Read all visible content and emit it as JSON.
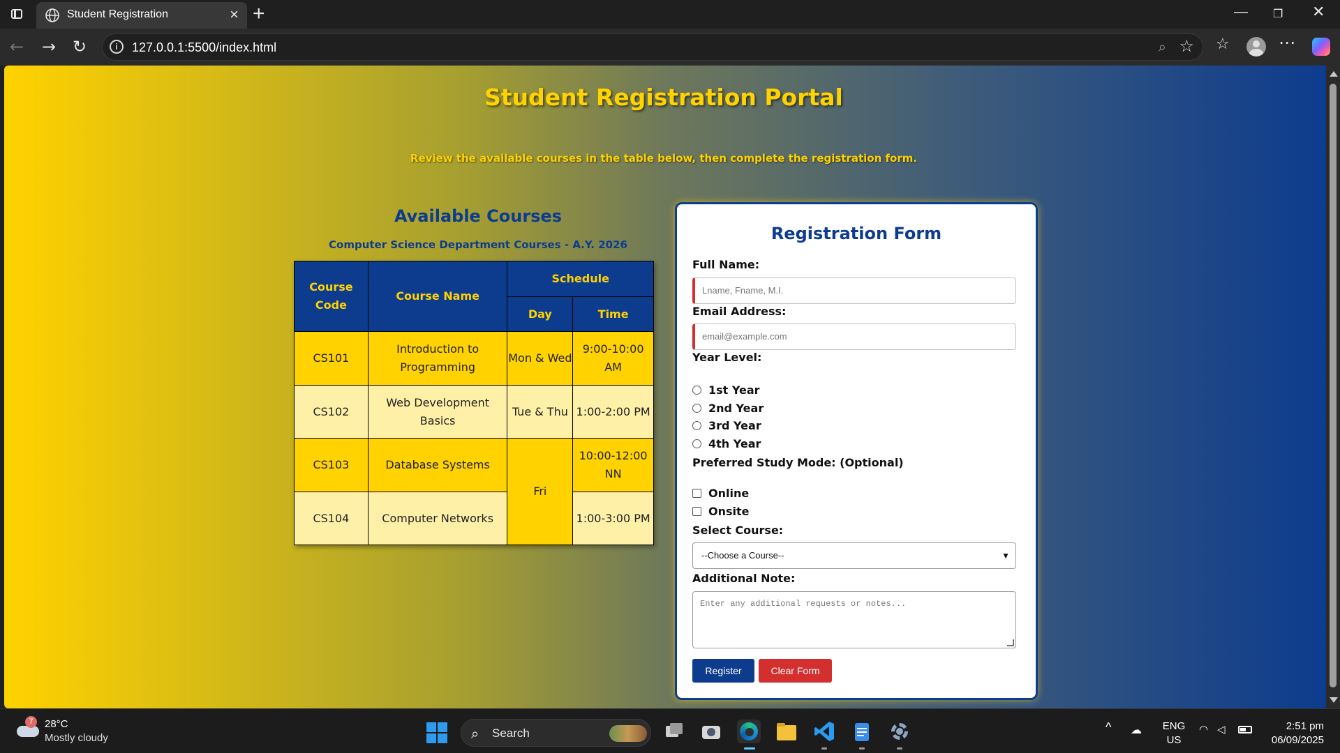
{
  "browser": {
    "tab_title": "Student Registration",
    "url": "127.0.0.1:5500/index.html"
  },
  "page": {
    "title": "Student Registration Portal",
    "subtitle": "Review the available courses in the table below, then complete the registration form."
  },
  "courses": {
    "title": "Available Courses",
    "caption": "Computer Science Department Courses - A.Y. 2026",
    "headers": {
      "code": "Course Code",
      "name": "Course Name",
      "schedule": "Schedule",
      "day": "Day",
      "time": "Time"
    },
    "rows": [
      {
        "code": "CS101",
        "name": "Introduction to Programming",
        "day": "Mon & Wed",
        "time": "9:00-10:00 AM"
      },
      {
        "code": "CS102",
        "name": "Web Development Basics",
        "day": "Tue & Thu",
        "time": "1:00-2:00 PM"
      },
      {
        "code": "CS103",
        "name": "Database Systems",
        "day": "Fri",
        "time": "10:00-12:00 NN"
      },
      {
        "code": "CS104",
        "name": "Computer Networks",
        "day": "Fri",
        "time": "1:00-3:00 PM"
      }
    ]
  },
  "form": {
    "title": "Registration Form",
    "full_name_label": "Full Name:",
    "full_name_placeholder": "Lname, Fname, M.I.",
    "full_name_value": "",
    "email_label": "Email Address:",
    "email_placeholder": "email@example.com",
    "email_value": "",
    "year_label": "Year Level:",
    "years": [
      "1st Year",
      "2nd Year",
      "3rd Year",
      "4th Year"
    ],
    "mode_label": "Preferred Study Mode: (Optional)",
    "modes": [
      "Online",
      "Onsite"
    ],
    "course_label": "Select Course:",
    "course_selected": "--Choose a Course--",
    "note_label": "Additional Note:",
    "note_placeholder": "Enter any additional requests or notes...",
    "register_label": "Register",
    "clear_label": "Clear Form"
  },
  "taskbar": {
    "weather_temp": "28°C",
    "weather_desc": "Mostly cloudy",
    "weather_badge": "7",
    "search_label": "Search",
    "lang_line1": "ENG",
    "lang_line2": "US",
    "time": "2:51 pm",
    "date": "06/09/2025"
  },
  "colors": {
    "navy": "#0d3c8e",
    "gold": "#ffd200",
    "light_gold": "#fff0a8",
    "red": "#d32f2f"
  }
}
